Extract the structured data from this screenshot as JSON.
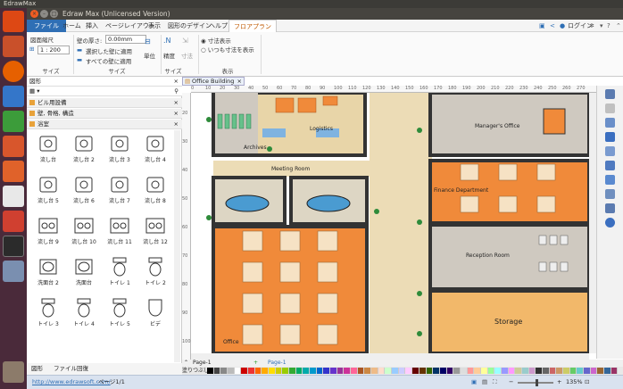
{
  "os_bar": {
    "title": "EdrawMax"
  },
  "window": {
    "title": "Edraw Max (Unlicensed Version)"
  },
  "menu": {
    "file": "ファイル",
    "home": "ホーム",
    "insert": "挿入",
    "page_layout": "ページレイアウト",
    "view": "表示",
    "shape_design": "図形のデザイン",
    "help": "ヘルプ",
    "floor_plan": "フロアプラン",
    "login": "ログイン"
  },
  "ribbon": {
    "scale_label": "図面縮尺",
    "scale_value": "1 : 200",
    "wall_thickness_label": "壁の厚さ:",
    "wall_thickness_value": "0.00mm",
    "apply_selected": "選択した壁に適用",
    "apply_all": "すべての壁に適用",
    "units_label": "単位",
    "precision_label": "精度",
    "dim_label": "寸法",
    "show_dims": "寸法表示",
    "always_show_dims": "いつも寸法を表示",
    "group_size1": "サイズ",
    "group_size2": "サイズ",
    "group_size3": "サイズ",
    "group_display": "表示"
  },
  "panel": {
    "title": "図形",
    "categories": [
      "ビル用設備",
      "壁, 骨格, 構造",
      "浴室"
    ],
    "shapes": [
      "流し台",
      "流し台 2",
      "流し台 3",
      "流し台 4",
      "流し台 5",
      "流し台 6",
      "流し台 7",
      "流し台 8",
      "流し台 9",
      "流し台 10",
      "流し台 11",
      "流し台 12",
      "洗面台 2",
      "洗面台",
      "トイレ 1",
      "トイレ 2",
      "トイレ 3",
      "トイレ 4",
      "トイレ 5",
      "ビデ"
    ],
    "tabs": [
      "図形",
      "ファイル回復"
    ]
  },
  "document": {
    "tab": "Office Building"
  },
  "ruler": {
    "h": [
      "0",
      "10",
      "20",
      "30",
      "40",
      "50",
      "60",
      "70",
      "80",
      "90",
      "100",
      "110",
      "120",
      "130",
      "140",
      "150",
      "160",
      "170",
      "180",
      "190",
      "200",
      "210",
      "220",
      "230",
      "240",
      "250",
      "260",
      "270"
    ],
    "v": [
      "20",
      "30",
      "40",
      "50",
      "60",
      "70",
      "80",
      "90",
      "100"
    ]
  },
  "floorplan": {
    "rooms": [
      "Logistics",
      "Archives",
      "Meeting Room",
      "Manager's Office",
      "Finance Department",
      "Reception Room",
      "Storage",
      "Office"
    ]
  },
  "pages": {
    "current": "Page-1",
    "tab": "Page-1",
    "fill_label": "塗りつぶし"
  },
  "status": {
    "url": "http://www.edrawsoft.com/",
    "page": "ページ1/1",
    "zoom": "135%"
  },
  "colors": {
    "accent": "#2f6fb5",
    "launcher": "#4a2a3a",
    "office_floor": "#f08a3a",
    "wood": "#e8d5a8"
  }
}
